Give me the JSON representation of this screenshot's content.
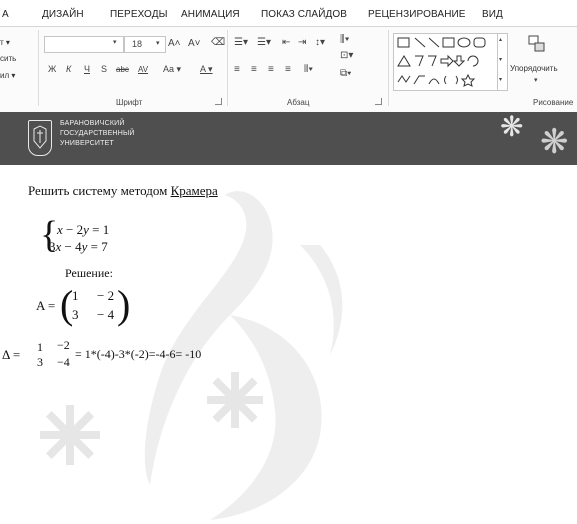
{
  "ribbon_tabs": [
    "А",
    "ДИЗАЙН",
    "ПЕРЕХОДЫ",
    "АНИМАЦИЯ",
    "ПОКАЗ СЛАЙДОВ",
    "РЕЦЕНЗИРОВАНИЕ",
    "ВИД"
  ],
  "clipboard": {
    "line1": "т ▾",
    "line2": "сить",
    "line3": "ил ▾"
  },
  "font": {
    "size": "18",
    "grow_label": "A˄",
    "shrink_label": "A˅",
    "bold": "Ж",
    "italic": "К",
    "underline": "Ч",
    "shadow": "S",
    "strike": "abc",
    "spacing": "AV",
    "case": "Aa ▾",
    "color": "A ▾",
    "group_label": "Шрифт"
  },
  "paragraph": {
    "group_label": "Абзац"
  },
  "drawing": {
    "arrange_label": "Упорядочить",
    "group_label": "Рисование"
  },
  "banner": {
    "university": [
      "БАРАНОВИЧСКИЙ",
      "ГОСУДАРСТВЕННЫЙ",
      "УНИВЕРСИТЕТ"
    ],
    "flake_glyph": "❋"
  },
  "slide": {
    "task_prefix": "Решить систему методом ",
    "task_link": "Крамера",
    "eq1": {
      "x": "x",
      "minus": " − 2",
      "y": "y",
      "rhs": " = 1"
    },
    "eq2": {
      "coef": "3",
      "x": "x",
      "minus": " − 4",
      "y": "y",
      "rhs": " = 7"
    },
    "solution_label": "Решение:",
    "matrix_name": "A =",
    "matrix": [
      [
        "1",
        "− 2"
      ],
      [
        "3",
        "− 4"
      ]
    ],
    "delta_symbol": "Δ =",
    "det": [
      [
        "1",
        "−2"
      ],
      [
        "3",
        "−4"
      ]
    ],
    "delta_calc": "= 1*(-4)-3*(-2)=-4-6= -10"
  }
}
